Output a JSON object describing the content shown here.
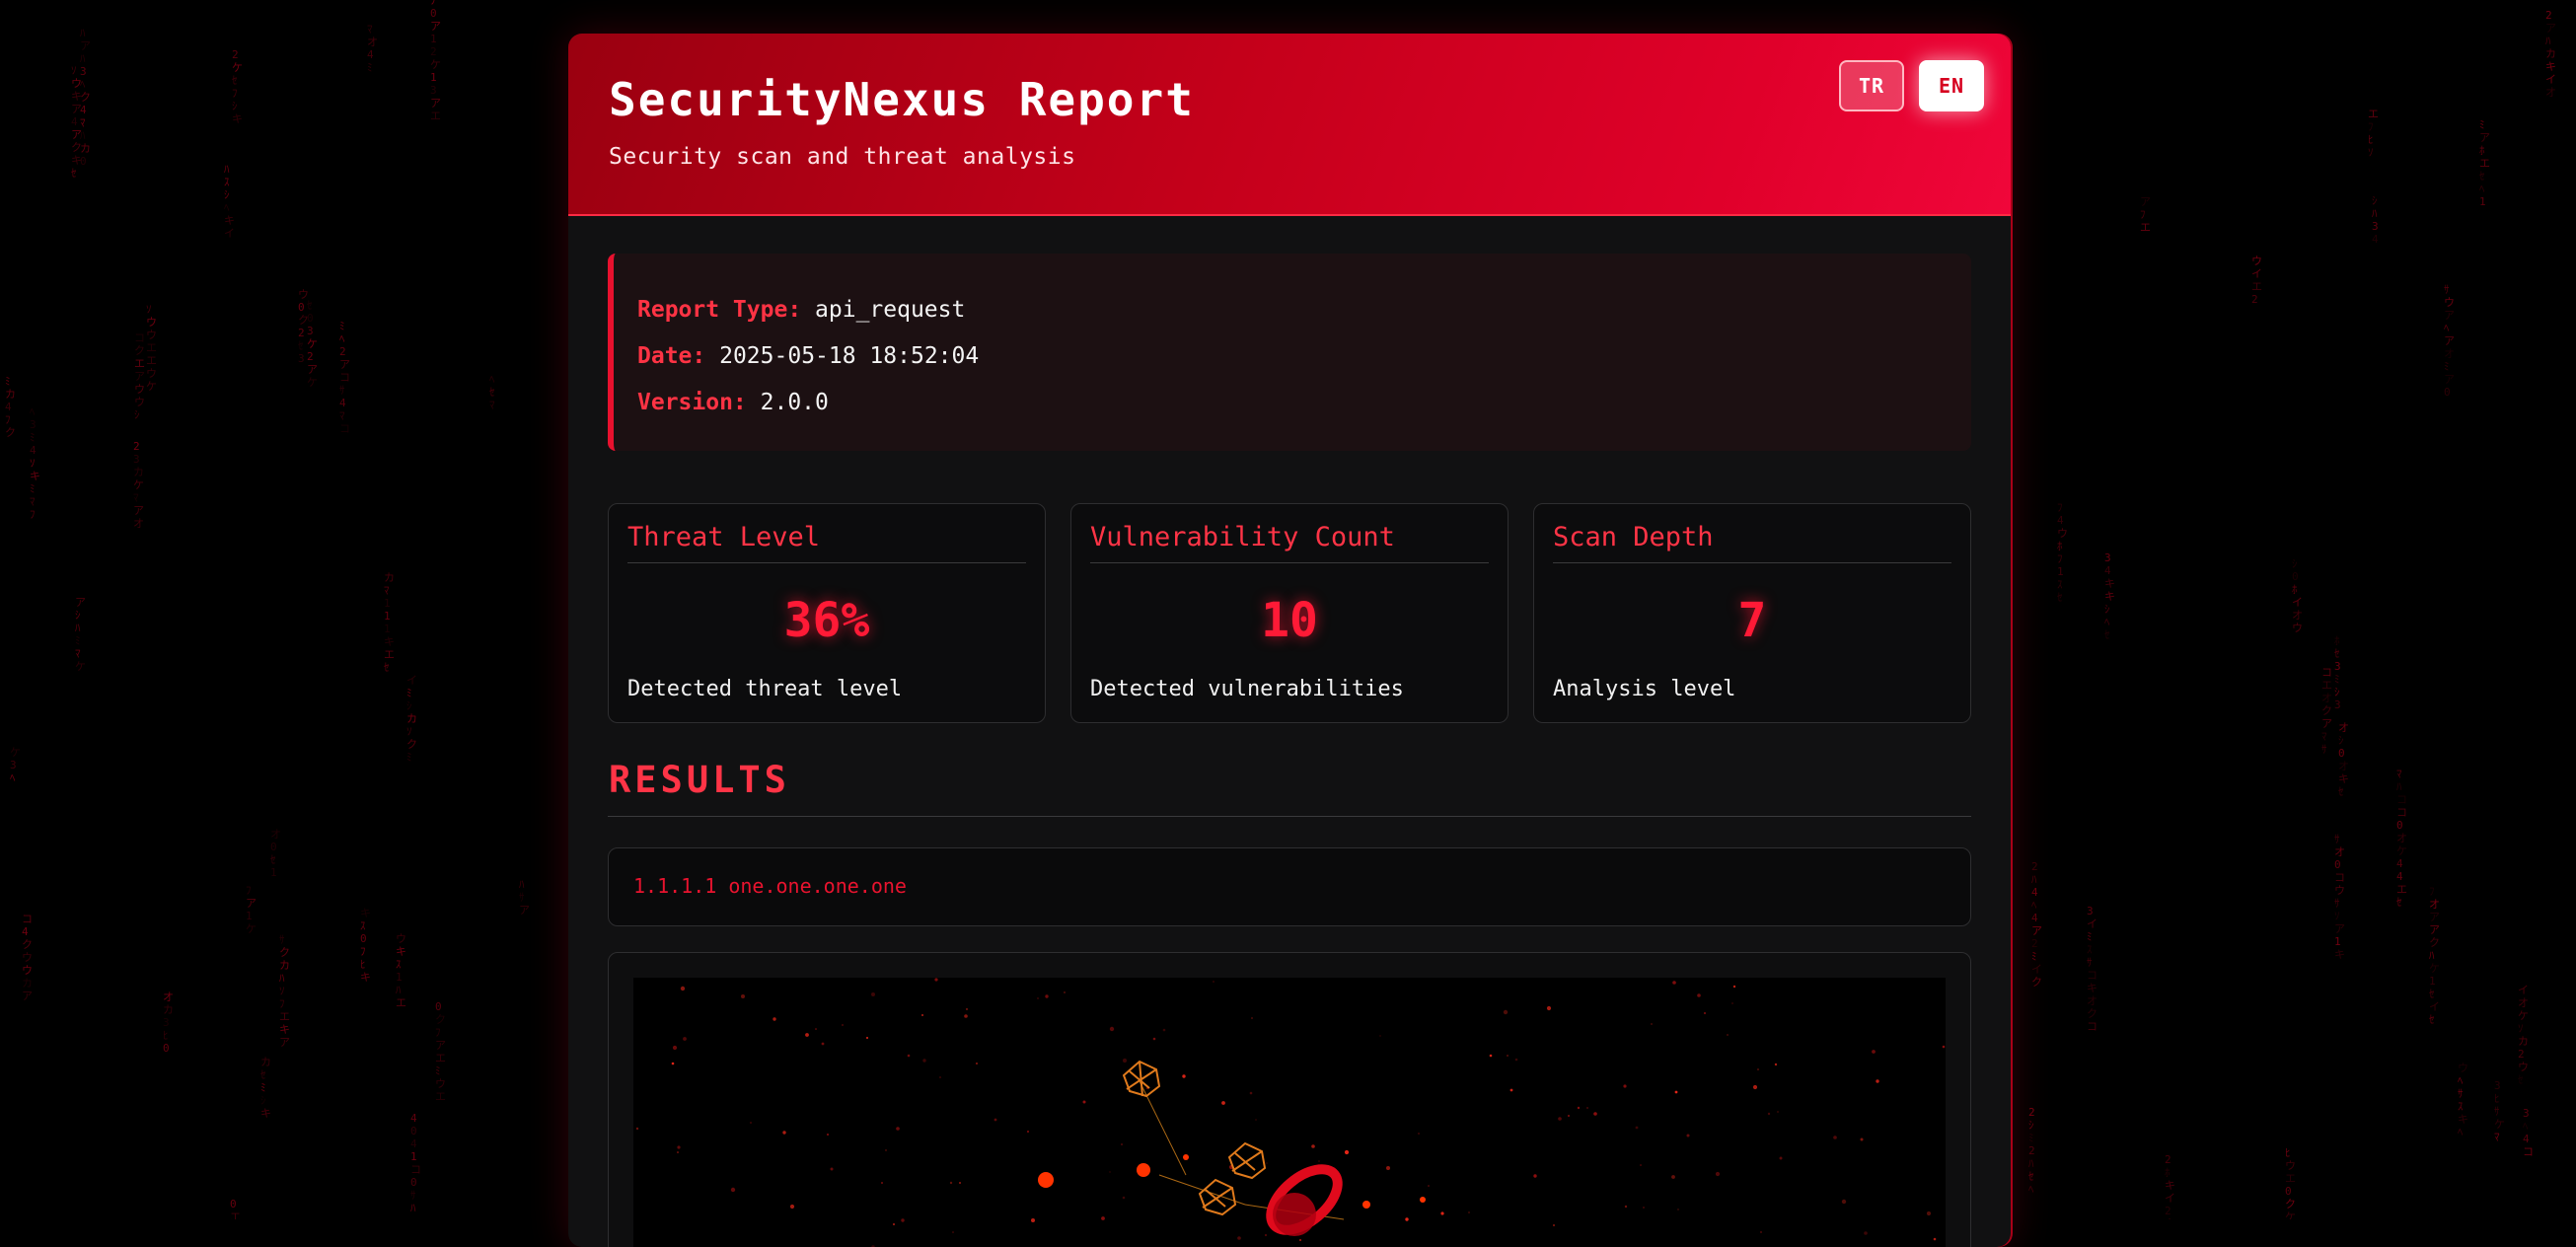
{
  "header": {
    "title": "SecurityNexus Report",
    "subtitle": "Security scan and threat analysis",
    "languages": [
      "TR",
      "EN"
    ],
    "active_language": "EN"
  },
  "meta": {
    "report_type_label": "Report Type:",
    "report_type": "api_request",
    "date_label": "Date:",
    "date": "2025-05-18 18:52:04",
    "version_label": "Version:",
    "version": "2.0.0"
  },
  "stats": [
    {
      "title": "Threat Level",
      "value": "36%",
      "description": "Detected threat level"
    },
    {
      "title": "Vulnerability Count",
      "value": "10",
      "description": "Detected vulnerabilities"
    },
    {
      "title": "Scan Depth",
      "value": "7",
      "description": "Analysis level"
    }
  ],
  "results": {
    "heading": "RESULTS",
    "entries": [
      "1.1.1.1 one.one.one.one"
    ]
  },
  "colors": {
    "accent": "#ff1a36",
    "header_start": "#9a0010",
    "header_end": "#f0063a",
    "background": "#000000",
    "card": "#111112"
  }
}
